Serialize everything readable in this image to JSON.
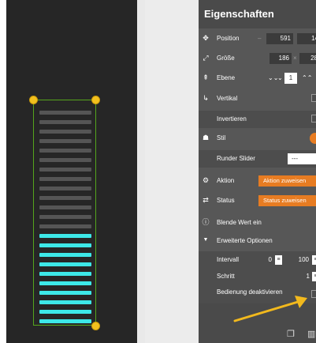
{
  "panel": {
    "title": "Eigenschaften",
    "rows": {
      "position": {
        "label": "Position",
        "x": "591",
        "y": "14"
      },
      "size": {
        "label": "Größe",
        "w": "186",
        "h": "28"
      },
      "layer": {
        "label": "Ebene",
        "value": "1"
      },
      "vertical": {
        "label": "Vertikal"
      },
      "invert": {
        "label": "Invertieren"
      },
      "style": {
        "label": "Stil"
      },
      "round_slider": {
        "label": "Runder Slider",
        "value": "---"
      },
      "actions": {
        "label": "Aktion",
        "button": "Aktion zuweisen"
      },
      "status": {
        "label": "Status",
        "button": "Status zuweisen"
      },
      "show_value": {
        "label": "Blende Wert ein"
      },
      "advanced": {
        "label": "Erweiterte Optionen"
      },
      "interval": {
        "label": "Intervall",
        "min": "0",
        "max": "100"
      },
      "step": {
        "label": "Schritt",
        "value": "1"
      },
      "disable": {
        "label": "Bedienung deaktivieren"
      }
    }
  },
  "colors": {
    "canvas_bg": "#262626",
    "bar_active": "#3de8e8",
    "bar_inactive": "#555555",
    "accent": "#e77c22",
    "frame": "#55a51c",
    "handle": "#f2c01e",
    "arrow": "#f2b91d"
  },
  "slider_widget": {
    "segments_total": 23,
    "segments_active": 10,
    "orientation": "vertical"
  },
  "icons": {
    "position": "move-icon",
    "size": "resize-icon",
    "layer": "layers-icon",
    "vertical": "vertical-icon",
    "style": "style-icon",
    "actions": "gear-icon",
    "status": "status-icon",
    "show_value": "info-icon",
    "advanced": "caret-down-icon"
  }
}
